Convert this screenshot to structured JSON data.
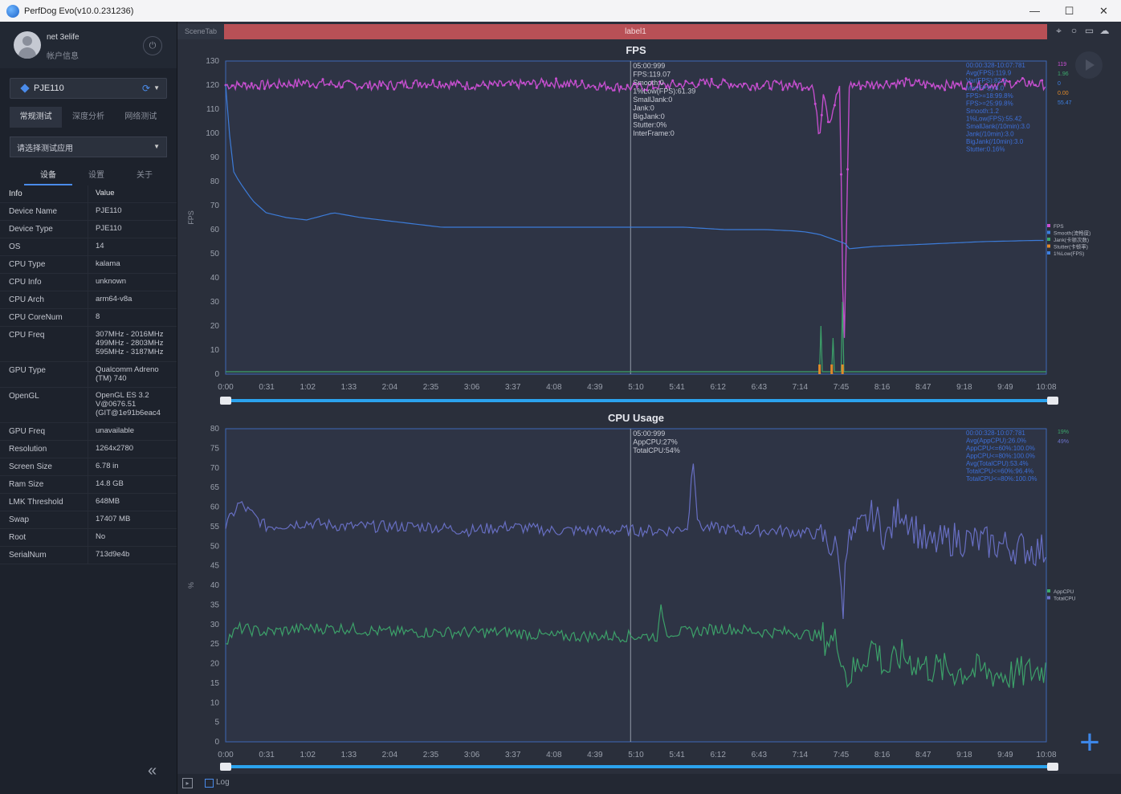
{
  "window": {
    "title": "PerfDog Evo(v10.0.231236)",
    "minimize": "—",
    "maximize": "☐",
    "close": "✕"
  },
  "sidebar": {
    "user": {
      "name": "net 3elife",
      "info": "帐户信息"
    },
    "device": {
      "name": "PJE110"
    },
    "mode_tabs": [
      "常规测试",
      "深度分析",
      "网络测试"
    ],
    "app_select_placeholder": "请选择测试应用",
    "sub_tabs": [
      "设备",
      "设置",
      "关于"
    ],
    "info_header": {
      "key": "Info",
      "value": "Value"
    },
    "info_rows": [
      {
        "key": "Device Name",
        "value": "PJE110"
      },
      {
        "key": "Device Type",
        "value": "PJE110"
      },
      {
        "key": "OS",
        "value": "14"
      },
      {
        "key": "CPU Type",
        "value": "kalama"
      },
      {
        "key": "CPU Info",
        "value": "unknown"
      },
      {
        "key": "CPU Arch",
        "value": "arm64-v8a"
      },
      {
        "key": "CPU CoreNum",
        "value": "8"
      },
      {
        "key": "CPU Freq",
        "value": "307MHz - 2016MHz\n499MHz - 2803MHz\n595MHz - 3187MHz"
      },
      {
        "key": "GPU Type",
        "value": "Qualcomm Adreno\n(TM) 740"
      },
      {
        "key": "OpenGL",
        "value": "OpenGL ES 3.2\nV@0676.51\n(GIT@1e91b6eac4"
      },
      {
        "key": "GPU Freq",
        "value": "unavailable"
      },
      {
        "key": "Resolution",
        "value": "1264x2780"
      },
      {
        "key": "Screen Size",
        "value": "6.78 in"
      },
      {
        "key": "Ram Size",
        "value": "14.8 GB"
      },
      {
        "key": "LMK Threshold",
        "value": "648MB"
      },
      {
        "key": "Swap",
        "value": "17407 MB"
      },
      {
        "key": "Root",
        "value": "No"
      },
      {
        "key": "SerialNum",
        "value": "713d9e4b"
      }
    ],
    "collapse_glyph": "«"
  },
  "main": {
    "scene_tab": "SceneTab",
    "label_bar": "label1",
    "bottom": {
      "log_label": "Log"
    }
  },
  "colors": {
    "fps": "#c94fd2",
    "fps_avg": "#3d7fe0",
    "jank": "#3da86c",
    "stutter": "#e08a2a",
    "appcpu": "#3da86c",
    "totalcpu": "#6a72c9",
    "info_blue": "#3d6fd8"
  },
  "chart_data": [
    {
      "type": "line",
      "title": "FPS",
      "ylabel": "FPS",
      "ylim": [
        0,
        130
      ],
      "yticks": [
        0,
        10,
        20,
        30,
        40,
        50,
        60,
        70,
        80,
        90,
        100,
        110,
        120,
        130
      ],
      "xticks": [
        "0:00",
        "0:31",
        "1:02",
        "1:33",
        "2:04",
        "2:35",
        "3:06",
        "3:37",
        "4:08",
        "4:39",
        "5:10",
        "5:41",
        "6:12",
        "6:43",
        "7:14",
        "7:45",
        "8:16",
        "8:47",
        "9:18",
        "9:49",
        "10:08"
      ],
      "xlim_seconds": [
        0,
        608
      ],
      "legend": [
        "FPS",
        "Smooth(流畅度)",
        "Jank(卡顿次数)",
        "Stutter(卡顿率)",
        "1%Low(FPS)"
      ],
      "legend_position": "right",
      "cursor_time_seconds": 300,
      "cursor_readout": [
        "05:00:999",
        "FPS:119.07",
        "Smooth:0",
        "1%Low(FPS):61.39",
        "SmallJank:0",
        "Jank:0",
        "BigJank:0",
        "Stutter:0%",
        "InterFrame:0"
      ],
      "summary": [
        "00:00:328-10:07:781",
        "Avg(FPS):119.9",
        "Var(FPS):82.2",
        "Min(FPS):4.0",
        "FPS>=18:99.8%",
        "FPS>=25:99.8%",
        "Smooth:1.2",
        "1%Low(FPS):55.42",
        "SmallJank(/10min):3.0",
        "Jank(/10min):3.0",
        "BigJank(/10min):3.0",
        "Stutter:0.16%"
      ],
      "right_values": [
        "119",
        "1.96",
        "0",
        "0.00",
        "55.47"
      ],
      "series": [
        {
          "name": "FPS",
          "x": [
            0,
            30,
            60,
            90,
            120,
            150,
            180,
            210,
            240,
            270,
            300,
            330,
            360,
            390,
            420,
            435,
            440,
            443,
            447,
            455,
            458,
            462,
            470,
            500,
            530,
            560,
            590,
            608
          ],
          "y": [
            120,
            120,
            121,
            120,
            120,
            121,
            120,
            120,
            121,
            120,
            119,
            120,
            121,
            120,
            120,
            120,
            98,
            119,
            104,
            120,
            4,
            120,
            120,
            121,
            120,
            120,
            121,
            120
          ]
        },
        {
          "name": "1%Low(FPS)",
          "x": [
            0,
            5,
            10,
            20,
            30,
            45,
            60,
            80,
            100,
            130,
            160,
            190,
            220,
            250,
            280,
            310,
            340,
            370,
            400,
            420,
            430,
            440,
            450,
            460,
            461,
            480,
            520,
            560,
            600,
            608
          ],
          "y": [
            120,
            85,
            80,
            72,
            67,
            65,
            64,
            67,
            65,
            63,
            61,
            61,
            61,
            61,
            61,
            61,
            61,
            60,
            60,
            59.5,
            59,
            58,
            56,
            54,
            52,
            53,
            54,
            55,
            55.5,
            55.5
          ]
        },
        {
          "name": "Jank(卡顿次数)",
          "x": [
            0,
            440,
            441,
            442,
            449,
            450,
            451,
            456,
            457,
            458,
            608
          ],
          "y": [
            1,
            1,
            20,
            1,
            1,
            15,
            1,
            1,
            30,
            1,
            1
          ]
        }
      ]
    },
    {
      "type": "line",
      "title": "CPU Usage",
      "ylabel": "%",
      "ylim": [
        0,
        80
      ],
      "yticks": [
        0,
        5,
        10,
        15,
        20,
        25,
        30,
        35,
        40,
        45,
        50,
        55,
        60,
        65,
        70,
        75,
        80
      ],
      "xticks": [
        "0:00",
        "0:31",
        "1:02",
        "1:33",
        "2:04",
        "2:35",
        "3:06",
        "3:37",
        "4:08",
        "4:39",
        "5:10",
        "5:41",
        "6:12",
        "6:43",
        "7:14",
        "7:45",
        "8:16",
        "8:47",
        "9:18",
        "9:49",
        "10:08"
      ],
      "xlim_seconds": [
        0,
        608
      ],
      "legend": [
        "AppCPU",
        "TotalCPU"
      ],
      "legend_position": "right",
      "cursor_time_seconds": 300,
      "cursor_readout": [
        "05:00:999",
        "AppCPU:27%",
        "TotalCPU:54%"
      ],
      "summary": [
        "00:00:328-10:07:781",
        "Avg(AppCPU):26.0%",
        "AppCPU<=60%:100.0%",
        "AppCPU<=80%:100.0%",
        "Avg(TotalCPU):53.4%",
        "TotalCPU<=60%:96.4%",
        "TotalCPU<=80%:100.0%"
      ],
      "right_values": [
        "19%",
        "49%"
      ],
      "series": [
        {
          "name": "TotalCPU",
          "x": [
            0,
            10,
            30,
            60,
            90,
            120,
            150,
            180,
            210,
            240,
            270,
            300,
            330,
            343,
            346,
            350,
            380,
            410,
            440,
            455,
            457,
            459,
            470,
            480,
            490,
            500,
            520,
            540,
            560,
            580,
            600,
            608
          ],
          "y": [
            55,
            61,
            55,
            56,
            55,
            55,
            55,
            54,
            55,
            54,
            54,
            54,
            54,
            55,
            75,
            55,
            54,
            54,
            53,
            48,
            27,
            50,
            54,
            58,
            52,
            60,
            50,
            52,
            51,
            50,
            49,
            49
          ]
        },
        {
          "name": "AppCPU",
          "x": [
            0,
            10,
            30,
            60,
            90,
            120,
            150,
            180,
            210,
            240,
            270,
            300,
            320,
            323,
            326,
            340,
            370,
            400,
            420,
            440,
            455,
            460,
            470,
            480,
            490,
            500,
            520,
            540,
            560,
            580,
            600,
            608
          ],
          "y": [
            26,
            29,
            28,
            29,
            29,
            28,
            28,
            28,
            28,
            27,
            27,
            27,
            27,
            35,
            28,
            28,
            29,
            28,
            28,
            27,
            25,
            16,
            20,
            25,
            18,
            22,
            19,
            18,
            18,
            17,
            18,
            19
          ]
        }
      ]
    }
  ]
}
